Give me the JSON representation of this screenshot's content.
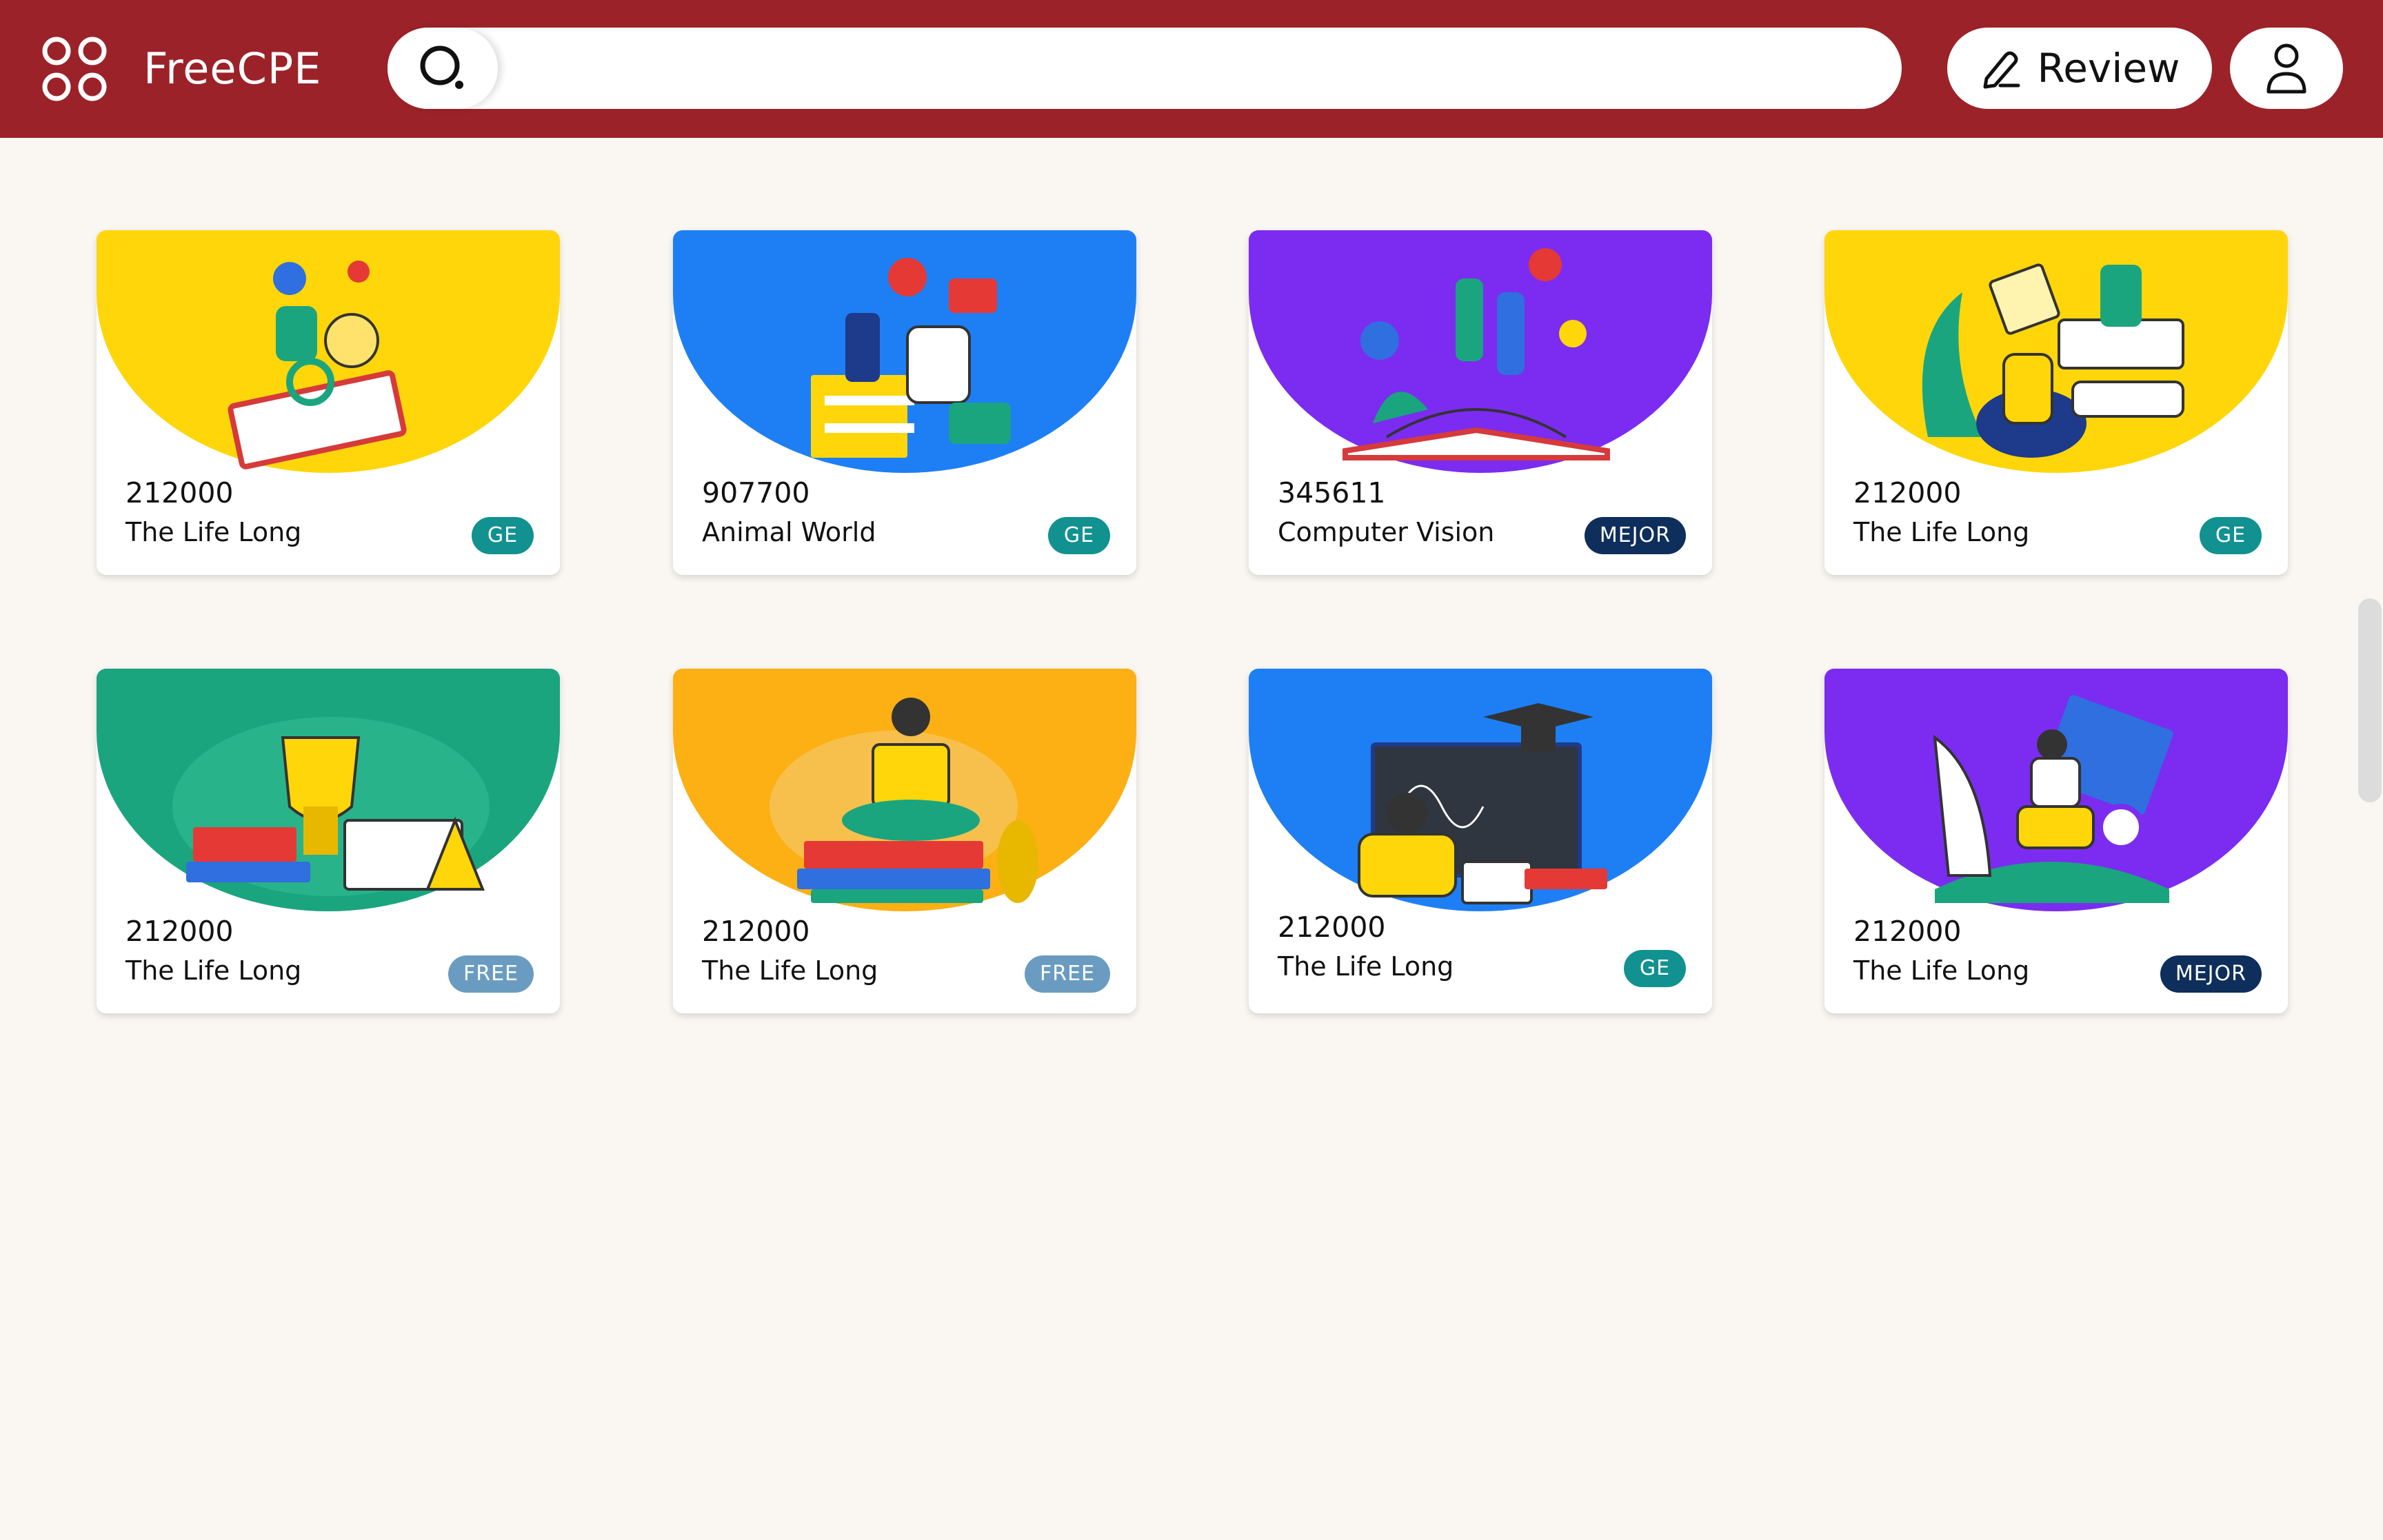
{
  "header": {
    "brand": "FreeCPE",
    "search_placeholder": "",
    "review_label": "Review",
    "background": "#9c2229"
  },
  "cards": [
    {
      "code": "212000",
      "title": "The Life Long",
      "badge": "GE",
      "color": "#ffd60a"
    },
    {
      "code": "907700",
      "title": "Animal World",
      "badge": "GE",
      "color": "#1e7ff5"
    },
    {
      "code": "345611",
      "title": "Computer Vision",
      "badge": "MEJOR",
      "color": "#7b2cf0"
    },
    {
      "code": "212000",
      "title": "The Life Long",
      "badge": "GE",
      "color": "#ffd60a"
    },
    {
      "code": "212000",
      "title": "The Life Long",
      "badge": "FREE",
      "color": "#1aa57f"
    },
    {
      "code": "212000",
      "title": "The Life Long",
      "badge": "FREE",
      "color": "#fcb014"
    },
    {
      "code": "212000",
      "title": "The Life Long",
      "badge": "GE",
      "color": "#1e7ff5"
    },
    {
      "code": "212000",
      "title": "The Life Long",
      "badge": "MEJOR",
      "color": "#7b2cf0"
    }
  ],
  "badge_colors": {
    "GE": "#11918f",
    "MEJOR": "#0e2e5c",
    "FREE": "#6a9cc1"
  }
}
